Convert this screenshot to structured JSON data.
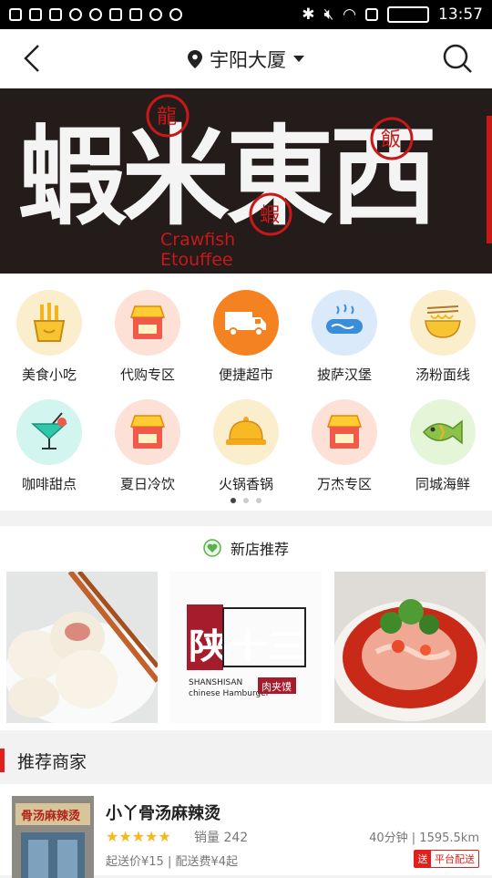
{
  "status_bar": {
    "time": "13:57"
  },
  "header": {
    "location": "宇阳大厦"
  },
  "banner": {
    "title_cn": "蝦米東西",
    "subtitle_en_1": "Crawfish",
    "subtitle_en_2": "Etouffee",
    "seal_1": "龍",
    "seal_2": "蝦",
    "seal_3": "飯"
  },
  "categories": [
    {
      "label": "美食小吃",
      "icon": "fries-icon",
      "bg": "#fbeecd"
    },
    {
      "label": "代购专区",
      "icon": "store-icon",
      "bg": "#fde0d6"
    },
    {
      "label": "便捷超市",
      "icon": "truck-icon",
      "bg": "#f58220"
    },
    {
      "label": "披萨汉堡",
      "icon": "sausage-icon",
      "bg": "#dbeafb"
    },
    {
      "label": "汤粉面线",
      "icon": "noodle-bowl-icon",
      "bg": "#fbeecd"
    },
    {
      "label": "咖啡甜点",
      "icon": "cocktail-icon",
      "bg": "#d2f5ef"
    },
    {
      "label": "夏日冷饮",
      "icon": "store-icon",
      "bg": "#fde0d6"
    },
    {
      "label": "火锅香锅",
      "icon": "cloche-icon",
      "bg": "#fbeecd"
    },
    {
      "label": "万杰专区",
      "icon": "store-icon",
      "bg": "#fde0d6"
    },
    {
      "label": "同城海鲜",
      "icon": "fish-icon",
      "bg": "#e4f5d8"
    }
  ],
  "new_store": {
    "title": "新店推荐",
    "logo_cn": "陕十三",
    "logo_en_1": "SHANSHISAN",
    "logo_en_2": "chinese Hamburger",
    "logo_tag": "肉夹馍"
  },
  "recommended": {
    "title": "推荐商家"
  },
  "shop": {
    "name": "小丫骨汤麻辣烫",
    "stars": "★★★★★",
    "sales": "销量 242",
    "distance": "40分钟 | 1595.5km",
    "fee": "起送价¥15 | 配送费¥4起",
    "badge": "平台配送",
    "badge_icon": "送",
    "sign": "骨汤麻辣烫"
  },
  "colors": {
    "accent": "#e0201c",
    "star": "#f6b81e"
  }
}
